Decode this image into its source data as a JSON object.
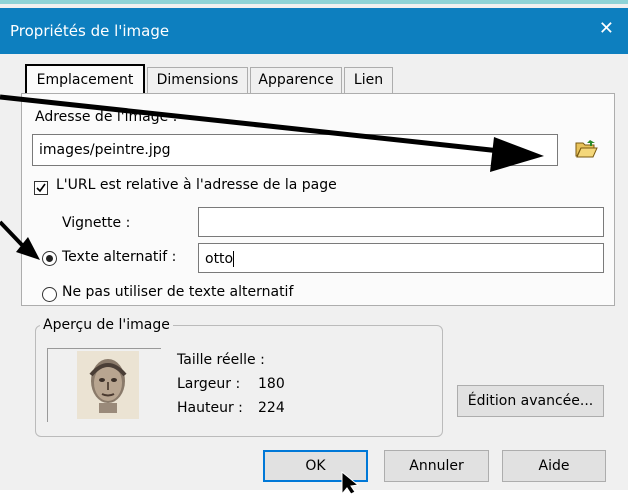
{
  "window": {
    "title": "Propriétés de l'image",
    "close_glyph": "✕"
  },
  "tabs": [
    {
      "label": "Emplacement",
      "active": true
    },
    {
      "label": "Dimensions",
      "active": false
    },
    {
      "label": "Apparence",
      "active": false
    },
    {
      "label": "Lien",
      "active": false
    }
  ],
  "location": {
    "address_label": "Adresse de l'image :",
    "address_value": "images/peintre.jpg",
    "relative_checkbox_label": "L'URL est relative à l'adresse de la page",
    "relative_checked": true,
    "vignette_label": "Vignette :",
    "vignette_value": "",
    "alt_radio_label": "Texte alternatif :",
    "alt_value": "otto",
    "no_alt_radio_label": "Ne pas utiliser de texte alternatif",
    "selected_radio": "alt"
  },
  "preview": {
    "legend": "Aperçu de l'image",
    "real_size_label": "Taille réelle :",
    "width_label": "Largeur :",
    "width_value": "180",
    "height_label": "Hauteur :",
    "height_value": "224",
    "advanced_button": "Édition avancée..."
  },
  "buttons": {
    "ok": "OK",
    "cancel": "Annuler",
    "help": "Aide"
  },
  "colors": {
    "titlebar": "#0d7fbf",
    "top_accent": "#8fd3d6",
    "default_button_border": "#0078d7"
  },
  "icons": [
    "close-icon",
    "folder-open-icon",
    "checkbox-checked-icon",
    "radio-selected-icon",
    "radio-unselected-icon",
    "portrait-thumbnail",
    "mouse-cursor-icon",
    "annotation-arrow"
  ]
}
